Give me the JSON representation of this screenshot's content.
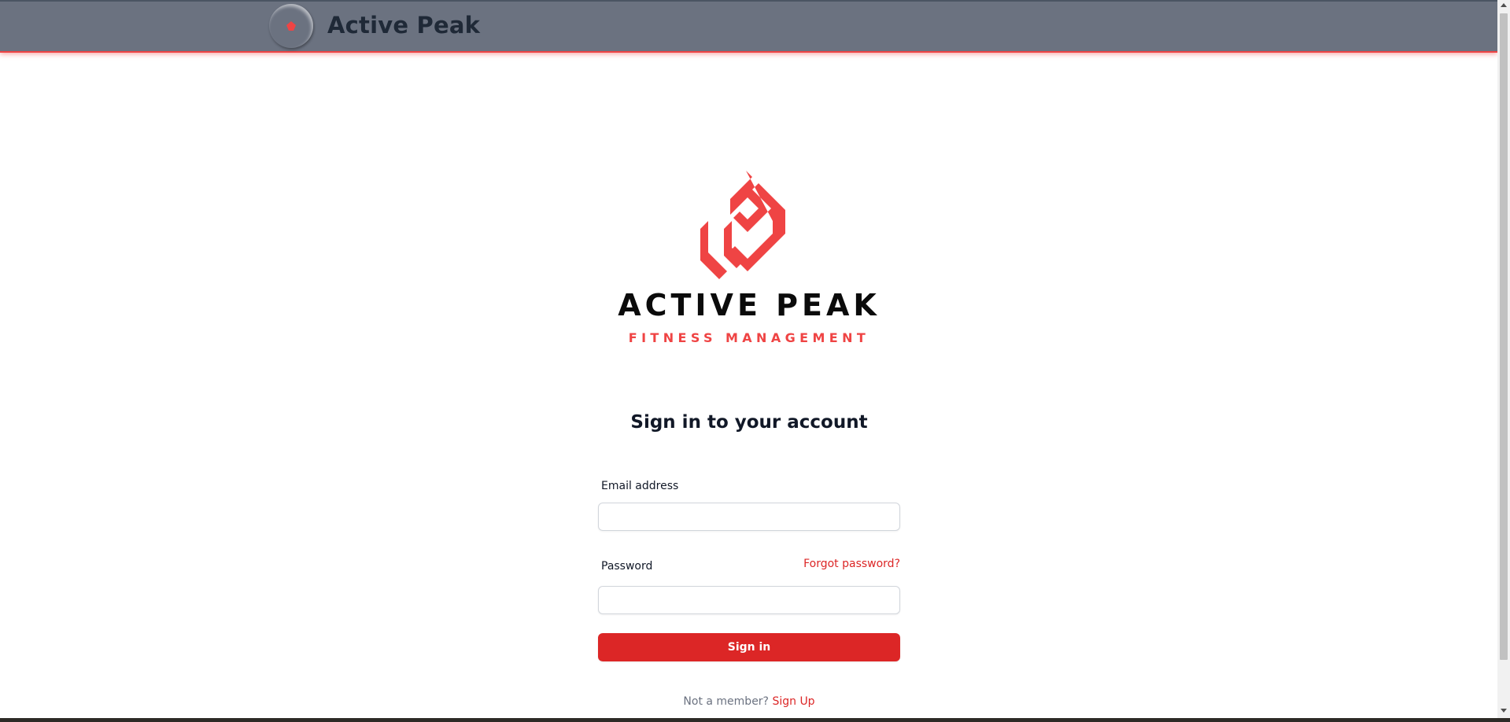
{
  "header": {
    "brand_name": "Active Peak",
    "logo_icon": "active-peak-logo-icon"
  },
  "logo": {
    "wordmark_main": "ACTIVE PEAK",
    "wordmark_sub": "FITNESS MANAGEMENT",
    "icon": "active-peak-logo-mark"
  },
  "form": {
    "title": "Sign in to your account",
    "email_label": "Email address",
    "email_value": "",
    "email_placeholder": "",
    "password_label": "Password",
    "password_value": "",
    "password_placeholder": "",
    "forgot_password": "Forgot password?",
    "submit_label": "Sign in",
    "signup_prompt": "Not a member?",
    "signup_link": "Sign Up"
  },
  "colors": {
    "header_bg": "#6b7280",
    "accent": "#dc2626",
    "logo_red": "#ef4444",
    "text_dark": "#111827"
  }
}
